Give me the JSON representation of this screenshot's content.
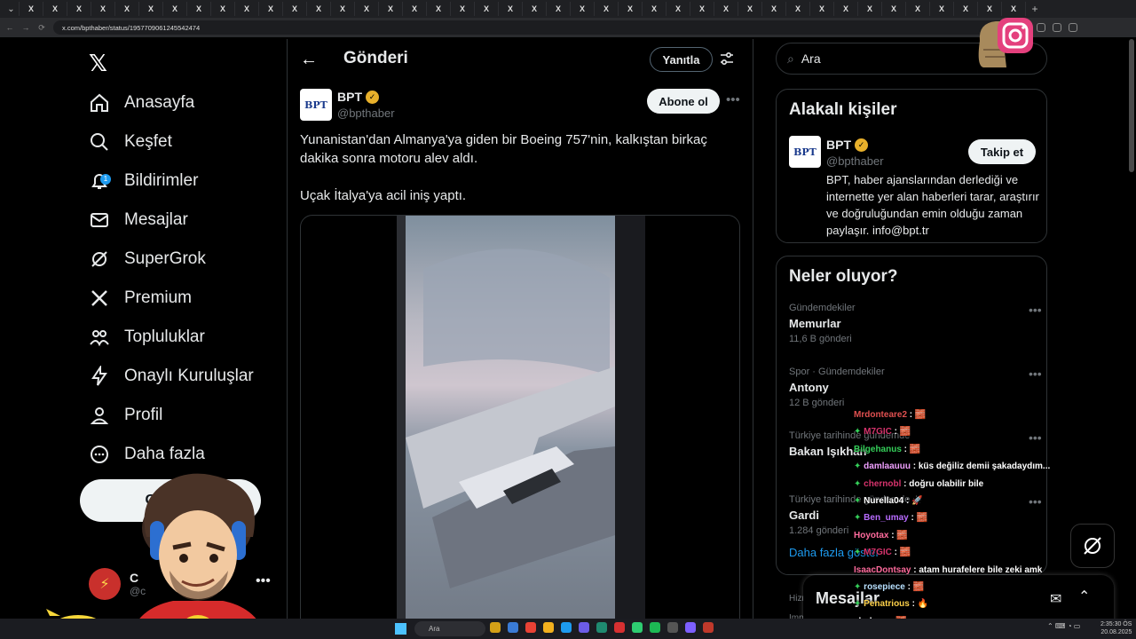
{
  "browser": {
    "tab_glyph": "X",
    "tab_count": 42,
    "url": "x.com/bpthaber/status/1957709061245542474"
  },
  "nav": {
    "items": [
      {
        "label": "Anasayfa",
        "icon": "home-icon"
      },
      {
        "label": "Keşfet",
        "icon": "search-icon"
      },
      {
        "label": "Bildirimler",
        "icon": "bell-icon",
        "badge": "1"
      },
      {
        "label": "Mesajlar",
        "icon": "mail-icon"
      },
      {
        "label": "SuperGrok",
        "icon": "grok-icon"
      },
      {
        "label": "Premium",
        "icon": "x-icon"
      },
      {
        "label": "Topluluklar",
        "icon": "communities-icon"
      },
      {
        "label": "Onaylı Kuruluşlar",
        "icon": "lightning-icon"
      },
      {
        "label": "Profil",
        "icon": "person-icon"
      },
      {
        "label": "Daha fazla",
        "icon": "more-circle-icon"
      }
    ],
    "post_button": "Gönder"
  },
  "main": {
    "title": "Gönderi",
    "reply_button": "Yanıtla",
    "post": {
      "author": "BPT",
      "handle": "@bpthaber",
      "follow_button": "Abone ol",
      "text1": "Yunanistan'dan Almanya'ya giden bir Boeing 757'nin, kalkıştan birkaç dakika sonra motoru alev aldı.",
      "text2": "Uçak İtalya'ya acil iniş yaptı.",
      "video_progress": 0.01
    }
  },
  "right": {
    "search_placeholder": "Ara",
    "related": {
      "title": "Alakalı kişiler",
      "name": "BPT",
      "handle": "@bpthaber",
      "follow_button": "Takip et",
      "bio": "BPT, haber ajanslarından derlediği ve internette yer alan haberleri tarar, araştırır ve doğruluğundan emin olduğu zaman paylaşır. info@bpt.tr"
    },
    "trends": {
      "title": "Neler oluyor?",
      "items": [
        {
          "category": "Gündemdekiler",
          "name": "Memurlar",
          "count": "11,6 B gönderi"
        },
        {
          "category": "Spor · Gündemdekiler",
          "name": "Antony",
          "count": "12 B gönderi"
        },
        {
          "category": "Türkiye tarihinde gündemde",
          "name": "Bakan Işıkhan",
          "count": ""
        },
        {
          "category": "Türkiye tarihinde gündemde",
          "name": "Gardi",
          "count": "1.284 gönderi"
        }
      ],
      "show_more": "Daha fazla göster"
    },
    "messages_title": "Mesajlar",
    "hint_lines": [
      "Hizm",
      "Impr"
    ]
  },
  "chat": [
    {
      "user": "Mrdonteare2",
      "color": "#e05050",
      "msg": "🧱",
      "sub": false
    },
    {
      "user": "M7GIC",
      "color": "#d6336c",
      "msg": "🧱",
      "sub": true
    },
    {
      "user": "Bilgehanus",
      "color": "#35d05a",
      "msg": "🧱",
      "sub": false
    },
    {
      "user": "damlaauuu",
      "color": "#f0a0ff",
      "msg": "küs değiliz demii şakadaydım...",
      "sub": true
    },
    {
      "user": "chernobl",
      "color": "#d6336c",
      "msg": "doğru olabilir bile",
      "sub": true
    },
    {
      "user": "Nurella04",
      "color": "#ffffff",
      "msg": "🚀",
      "sub": true
    },
    {
      "user": "Ben_umay",
      "color": "#b86bff",
      "msg": "🧱",
      "sub": true
    },
    {
      "user": "Hoyotax",
      "color": "#ff6b9d",
      "msg": "🧱",
      "sub": false
    },
    {
      "user": "M7GIC",
      "color": "#d6336c",
      "msg": "🧱",
      "sub": true
    },
    {
      "user": "IsaacDontsay",
      "color": "#ff6b9d",
      "msg": "atam hurafelere bile zeki amk",
      "sub": false
    },
    {
      "user": "rosepiece",
      "color": "#b8e0ff",
      "msg": "🧱",
      "sub": true
    },
    {
      "user": "Penatrious",
      "color": "#ffd24a",
      "msg": "🔥",
      "sub": true
    },
    {
      "user": "abolynn",
      "color": "#ffffff",
      "msg": "🧱",
      "sub": false
    }
  ],
  "profile_mini": {
    "name": "C",
    "handle": "@c"
  },
  "taskbar": {
    "search": "Ara",
    "time": "2:35:30 ÖS",
    "date": "20.08.2025"
  },
  "colors": {
    "accent": "#1d9bf0",
    "verified": "#e8b02b",
    "background": "#000000"
  }
}
